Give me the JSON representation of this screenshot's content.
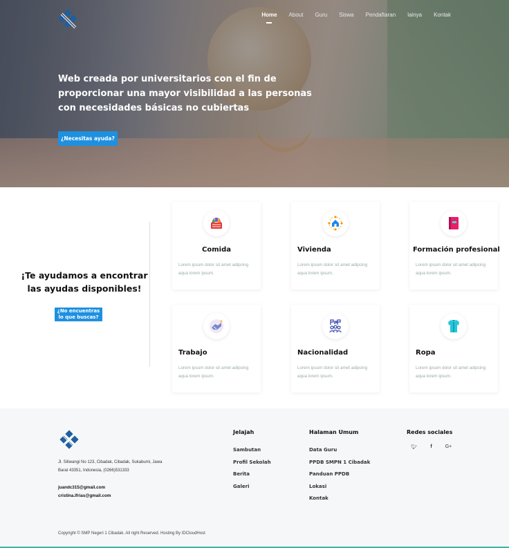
{
  "nav": {
    "items": [
      "Home",
      "About",
      "Guru",
      "Siswa",
      "Pendaftaran",
      "lainya",
      "Kontak"
    ]
  },
  "hero": {
    "headline": "Web creada por universitarios con el fin de proporcionar una mayor visibilidad a las personas con necesidades básicas no cubiertas",
    "button": "¿Necesitas ayuda?"
  },
  "help": {
    "title": "¡Te ayudamos a encontrar las ayudas disponibles!",
    "button": "¿No encuentras lo que buscas?"
  },
  "cards": [
    {
      "title": "Comida",
      "text": "Lorem ipsum dolor sit amet adipcing aqua lorem ipsum.",
      "icon": "food-basket-icon"
    },
    {
      "title": "Vivienda",
      "text": "Lorem ipsum dolor sit amet adipcing aqua lorem ipsum.",
      "icon": "house-network-icon"
    },
    {
      "title": "Formación profesional",
      "text": "Lorem ipsum dolor sit amet adipcing aqua lorem ipsum.",
      "icon": "book-icon"
    },
    {
      "title": "Trabajo",
      "text": "Lorem ipsum dolor sit amet adipcing aqua lorem ipsum.",
      "icon": "handshake-icon"
    },
    {
      "title": "Nacionalidad",
      "text": "Lorem ipsum dolor sit amet adipcing aqua lorem ipsum.",
      "icon": "people-flags-icon"
    },
    {
      "title": "Ropa",
      "text": "Lorem ipsum dolor sit amet adipcing aqua lorem ipsum.",
      "icon": "shirt-icon"
    }
  ],
  "footer": {
    "address": "Jl. Siliwangi No 123, Cibadak, Cibadak, Sukabumi, Jawa Barat 43351, Indonesia, (0266)531333",
    "email1": "juandc315@gmail.com",
    "email2": "cristina.lfrias@gmail.com",
    "jelajah": {
      "title": "Jelajah",
      "links": [
        "Sambutan",
        "Profil Sekolah",
        "Berita",
        "Galeri"
      ]
    },
    "halaman": {
      "title": "Halaman Umum",
      "links": [
        "Data Guru",
        "PPDB SMPN 1 Cibadak",
        "Panduan PPDB",
        "Lokasi",
        "Kontak"
      ]
    },
    "social": {
      "title": "Redes sociales",
      "icons": [
        "twitter-icon",
        "facebook-icon",
        "google-plus-icon"
      ]
    },
    "copyright": "Copyright © SMP Negeri 1 Cibadak. All right Reserved. Hosting By IDCloudHost"
  },
  "colors": {
    "accent": "#1e90e0",
    "footer_line": "#3bb3a8"
  }
}
